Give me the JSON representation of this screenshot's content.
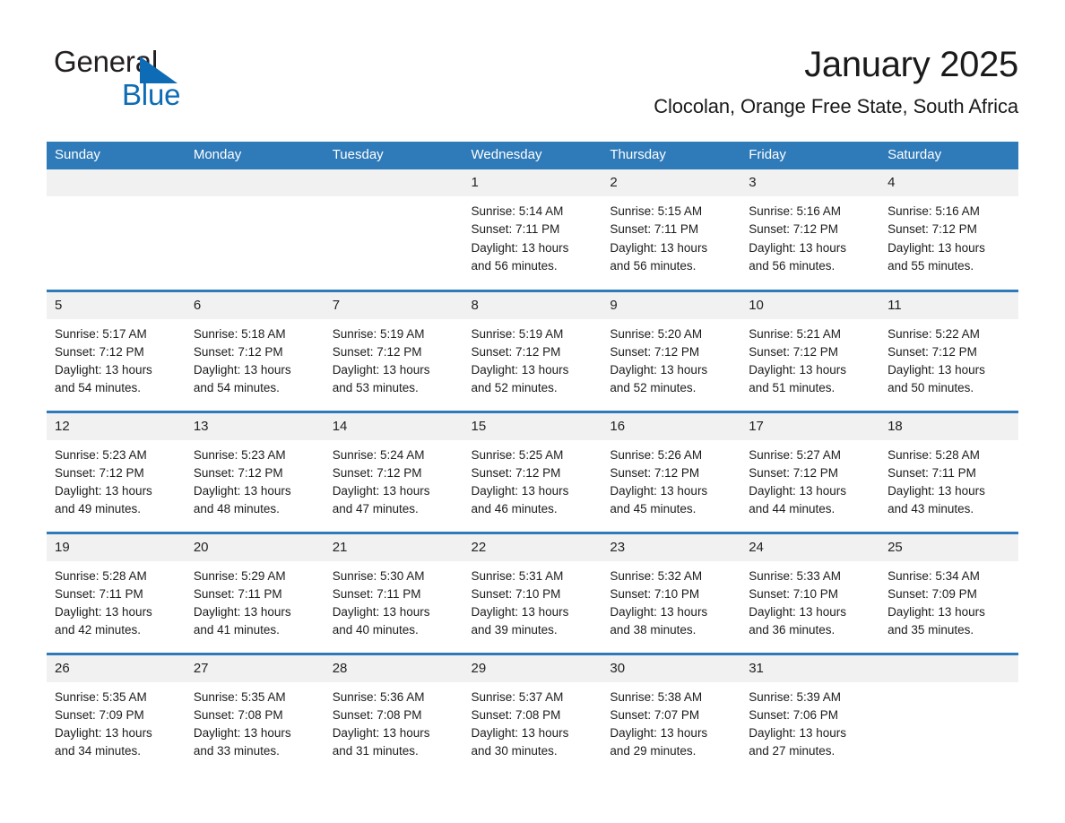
{
  "brand": {
    "word_general": "General",
    "word_blue": "Blue",
    "triangle_icon": "brand-triangle-icon",
    "accent_color": "#0d6cb5"
  },
  "header": {
    "month_title": "January 2025",
    "location": "Clocolan, Orange Free State, South Africa"
  },
  "theme": {
    "header_bar": "#2f7ab8",
    "day_band": "#f1f1f1",
    "text": "#1c1c1c",
    "page_bg": "#ffffff"
  },
  "weekday_headers": [
    "Sunday",
    "Monday",
    "Tuesday",
    "Wednesday",
    "Thursday",
    "Friday",
    "Saturday"
  ],
  "labels": {
    "sunrise_prefix": "Sunrise:",
    "sunset_prefix": "Sunset:",
    "daylight_prefix": "Daylight:"
  },
  "weeks": [
    [
      {
        "day": "",
        "blank": true
      },
      {
        "day": "",
        "blank": true
      },
      {
        "day": "",
        "blank": true
      },
      {
        "day": "1",
        "sunrise": "Sunrise: 5:14 AM",
        "sunset": "Sunset: 7:11 PM",
        "daylight_line1": "Daylight: 13 hours",
        "daylight_line2": "and 56 minutes."
      },
      {
        "day": "2",
        "sunrise": "Sunrise: 5:15 AM",
        "sunset": "Sunset: 7:11 PM",
        "daylight_line1": "Daylight: 13 hours",
        "daylight_line2": "and 56 minutes."
      },
      {
        "day": "3",
        "sunrise": "Sunrise: 5:16 AM",
        "sunset": "Sunset: 7:12 PM",
        "daylight_line1": "Daylight: 13 hours",
        "daylight_line2": "and 56 minutes."
      },
      {
        "day": "4",
        "sunrise": "Sunrise: 5:16 AM",
        "sunset": "Sunset: 7:12 PM",
        "daylight_line1": "Daylight: 13 hours",
        "daylight_line2": "and 55 minutes."
      }
    ],
    [
      {
        "day": "5",
        "sunrise": "Sunrise: 5:17 AM",
        "sunset": "Sunset: 7:12 PM",
        "daylight_line1": "Daylight: 13 hours",
        "daylight_line2": "and 54 minutes."
      },
      {
        "day": "6",
        "sunrise": "Sunrise: 5:18 AM",
        "sunset": "Sunset: 7:12 PM",
        "daylight_line1": "Daylight: 13 hours",
        "daylight_line2": "and 54 minutes."
      },
      {
        "day": "7",
        "sunrise": "Sunrise: 5:19 AM",
        "sunset": "Sunset: 7:12 PM",
        "daylight_line1": "Daylight: 13 hours",
        "daylight_line2": "and 53 minutes."
      },
      {
        "day": "8",
        "sunrise": "Sunrise: 5:19 AM",
        "sunset": "Sunset: 7:12 PM",
        "daylight_line1": "Daylight: 13 hours",
        "daylight_line2": "and 52 minutes."
      },
      {
        "day": "9",
        "sunrise": "Sunrise: 5:20 AM",
        "sunset": "Sunset: 7:12 PM",
        "daylight_line1": "Daylight: 13 hours",
        "daylight_line2": "and 52 minutes."
      },
      {
        "day": "10",
        "sunrise": "Sunrise: 5:21 AM",
        "sunset": "Sunset: 7:12 PM",
        "daylight_line1": "Daylight: 13 hours",
        "daylight_line2": "and 51 minutes."
      },
      {
        "day": "11",
        "sunrise": "Sunrise: 5:22 AM",
        "sunset": "Sunset: 7:12 PM",
        "daylight_line1": "Daylight: 13 hours",
        "daylight_line2": "and 50 minutes."
      }
    ],
    [
      {
        "day": "12",
        "sunrise": "Sunrise: 5:23 AM",
        "sunset": "Sunset: 7:12 PM",
        "daylight_line1": "Daylight: 13 hours",
        "daylight_line2": "and 49 minutes."
      },
      {
        "day": "13",
        "sunrise": "Sunrise: 5:23 AM",
        "sunset": "Sunset: 7:12 PM",
        "daylight_line1": "Daylight: 13 hours",
        "daylight_line2": "and 48 minutes."
      },
      {
        "day": "14",
        "sunrise": "Sunrise: 5:24 AM",
        "sunset": "Sunset: 7:12 PM",
        "daylight_line1": "Daylight: 13 hours",
        "daylight_line2": "and 47 minutes."
      },
      {
        "day": "15",
        "sunrise": "Sunrise: 5:25 AM",
        "sunset": "Sunset: 7:12 PM",
        "daylight_line1": "Daylight: 13 hours",
        "daylight_line2": "and 46 minutes."
      },
      {
        "day": "16",
        "sunrise": "Sunrise: 5:26 AM",
        "sunset": "Sunset: 7:12 PM",
        "daylight_line1": "Daylight: 13 hours",
        "daylight_line2": "and 45 minutes."
      },
      {
        "day": "17",
        "sunrise": "Sunrise: 5:27 AM",
        "sunset": "Sunset: 7:12 PM",
        "daylight_line1": "Daylight: 13 hours",
        "daylight_line2": "and 44 minutes."
      },
      {
        "day": "18",
        "sunrise": "Sunrise: 5:28 AM",
        "sunset": "Sunset: 7:11 PM",
        "daylight_line1": "Daylight: 13 hours",
        "daylight_line2": "and 43 minutes."
      }
    ],
    [
      {
        "day": "19",
        "sunrise": "Sunrise: 5:28 AM",
        "sunset": "Sunset: 7:11 PM",
        "daylight_line1": "Daylight: 13 hours",
        "daylight_line2": "and 42 minutes."
      },
      {
        "day": "20",
        "sunrise": "Sunrise: 5:29 AM",
        "sunset": "Sunset: 7:11 PM",
        "daylight_line1": "Daylight: 13 hours",
        "daylight_line2": "and 41 minutes."
      },
      {
        "day": "21",
        "sunrise": "Sunrise: 5:30 AM",
        "sunset": "Sunset: 7:11 PM",
        "daylight_line1": "Daylight: 13 hours",
        "daylight_line2": "and 40 minutes."
      },
      {
        "day": "22",
        "sunrise": "Sunrise: 5:31 AM",
        "sunset": "Sunset: 7:10 PM",
        "daylight_line1": "Daylight: 13 hours",
        "daylight_line2": "and 39 minutes."
      },
      {
        "day": "23",
        "sunrise": "Sunrise: 5:32 AM",
        "sunset": "Sunset: 7:10 PM",
        "daylight_line1": "Daylight: 13 hours",
        "daylight_line2": "and 38 minutes."
      },
      {
        "day": "24",
        "sunrise": "Sunrise: 5:33 AM",
        "sunset": "Sunset: 7:10 PM",
        "daylight_line1": "Daylight: 13 hours",
        "daylight_line2": "and 36 minutes."
      },
      {
        "day": "25",
        "sunrise": "Sunrise: 5:34 AM",
        "sunset": "Sunset: 7:09 PM",
        "daylight_line1": "Daylight: 13 hours",
        "daylight_line2": "and 35 minutes."
      }
    ],
    [
      {
        "day": "26",
        "sunrise": "Sunrise: 5:35 AM",
        "sunset": "Sunset: 7:09 PM",
        "daylight_line1": "Daylight: 13 hours",
        "daylight_line2": "and 34 minutes."
      },
      {
        "day": "27",
        "sunrise": "Sunrise: 5:35 AM",
        "sunset": "Sunset: 7:08 PM",
        "daylight_line1": "Daylight: 13 hours",
        "daylight_line2": "and 33 minutes."
      },
      {
        "day": "28",
        "sunrise": "Sunrise: 5:36 AM",
        "sunset": "Sunset: 7:08 PM",
        "daylight_line1": "Daylight: 13 hours",
        "daylight_line2": "and 31 minutes."
      },
      {
        "day": "29",
        "sunrise": "Sunrise: 5:37 AM",
        "sunset": "Sunset: 7:08 PM",
        "daylight_line1": "Daylight: 13 hours",
        "daylight_line2": "and 30 minutes."
      },
      {
        "day": "30",
        "sunrise": "Sunrise: 5:38 AM",
        "sunset": "Sunset: 7:07 PM",
        "daylight_line1": "Daylight: 13 hours",
        "daylight_line2": "and 29 minutes."
      },
      {
        "day": "31",
        "sunrise": "Sunrise: 5:39 AM",
        "sunset": "Sunset: 7:06 PM",
        "daylight_line1": "Daylight: 13 hours",
        "daylight_line2": "and 27 minutes."
      },
      {
        "day": "",
        "blank": true
      }
    ]
  ]
}
